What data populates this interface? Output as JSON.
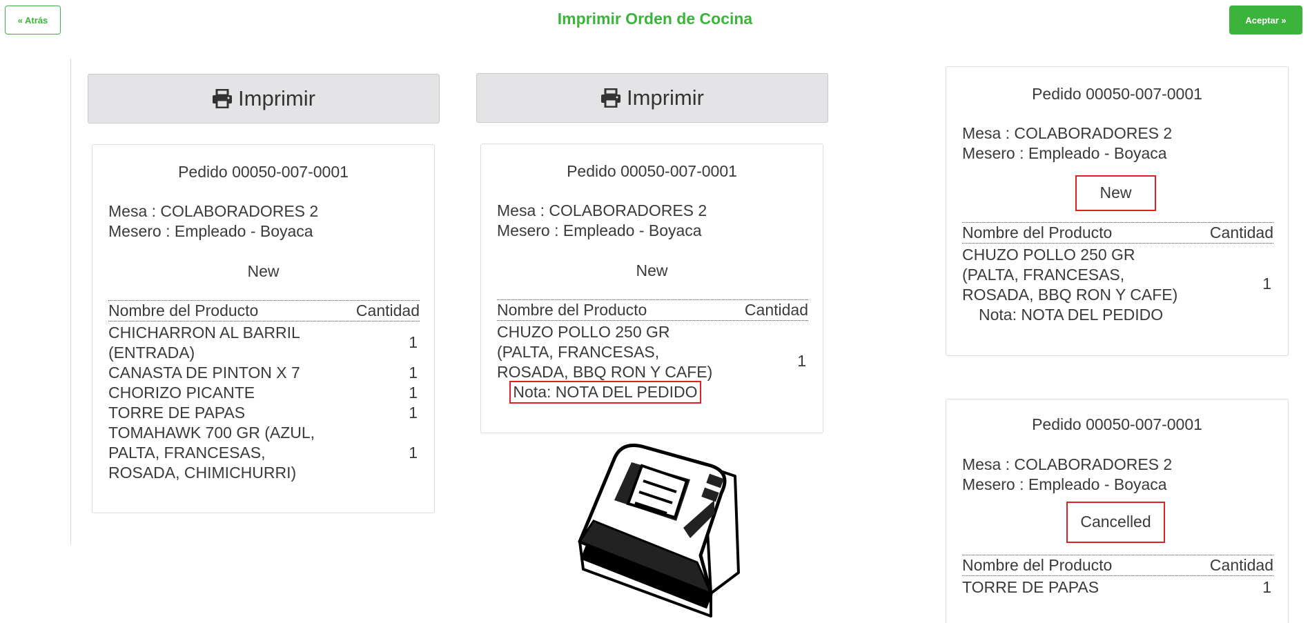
{
  "header": {
    "title": "Imprimir Orden de Cocina",
    "back_label": "« Atrás",
    "accept_label": "Aceptar »"
  },
  "print_label": "Imprimir",
  "colors": {
    "accent": "#3cb43c",
    "highlight": "#e02020"
  },
  "tickets": [
    {
      "title": "Pedido 00050-007-0001",
      "mesa": "Mesa : COLABORADORES 2",
      "mesero": "Mesero : Empleado - Boyaca",
      "status": "New",
      "col_product": "Nombre del Producto",
      "col_qty": "Cantidad",
      "items": [
        {
          "lines": [
            "CHICHARRON AL BARRIL",
            "(ENTRADA)"
          ],
          "qty": "1"
        },
        {
          "lines": [
            "CANASTA DE PINTON X 7"
          ],
          "qty": "1"
        },
        {
          "lines": [
            "CHORIZO PICANTE"
          ],
          "qty": "1"
        },
        {
          "lines": [
            "TORRE DE PAPAS"
          ],
          "qty": "1"
        },
        {
          "lines": [
            "TOMAHAWK 700 GR (AZUL,",
            "PALTA, FRANCESAS,",
            "ROSADA, CHIMICHURRI)"
          ],
          "qty": "1"
        }
      ]
    },
    {
      "title": "Pedido 00050-007-0001",
      "mesa": "Mesa : COLABORADORES 2",
      "mesero": "Mesero : Empleado - Boyaca",
      "status": "New",
      "col_product": "Nombre del Producto",
      "col_qty": "Cantidad",
      "items": [
        {
          "lines": [
            "CHUZO POLLO 250 GR",
            "(PALTA, FRANCESAS,",
            "ROSADA, BBQ RON Y CAFE)"
          ],
          "qty": "1",
          "note": "Nota: NOTA DEL PEDIDO"
        }
      ]
    },
    {
      "title": "Pedido 00050-007-0001",
      "mesa": "Mesa : COLABORADORES 2",
      "mesero": "Mesero : Empleado - Boyaca",
      "status": "New",
      "col_product": "Nombre del Producto",
      "col_qty": "Cantidad",
      "items": [
        {
          "lines": [
            "CHUZO POLLO 250 GR",
            "(PALTA, FRANCESAS,",
            "ROSADA, BBQ RON Y CAFE)"
          ],
          "qty": "1",
          "note": "Nota: NOTA DEL PEDIDO"
        }
      ]
    },
    {
      "title": "Pedido 00050-007-0001",
      "mesa": "Mesa : COLABORADORES 2",
      "mesero": "Mesero : Empleado - Boyaca",
      "status": "Cancelled",
      "col_product": "Nombre del Producto",
      "col_qty": "Cantidad",
      "items": [
        {
          "lines": [
            "TORRE DE PAPAS"
          ],
          "qty": "1"
        }
      ]
    }
  ]
}
